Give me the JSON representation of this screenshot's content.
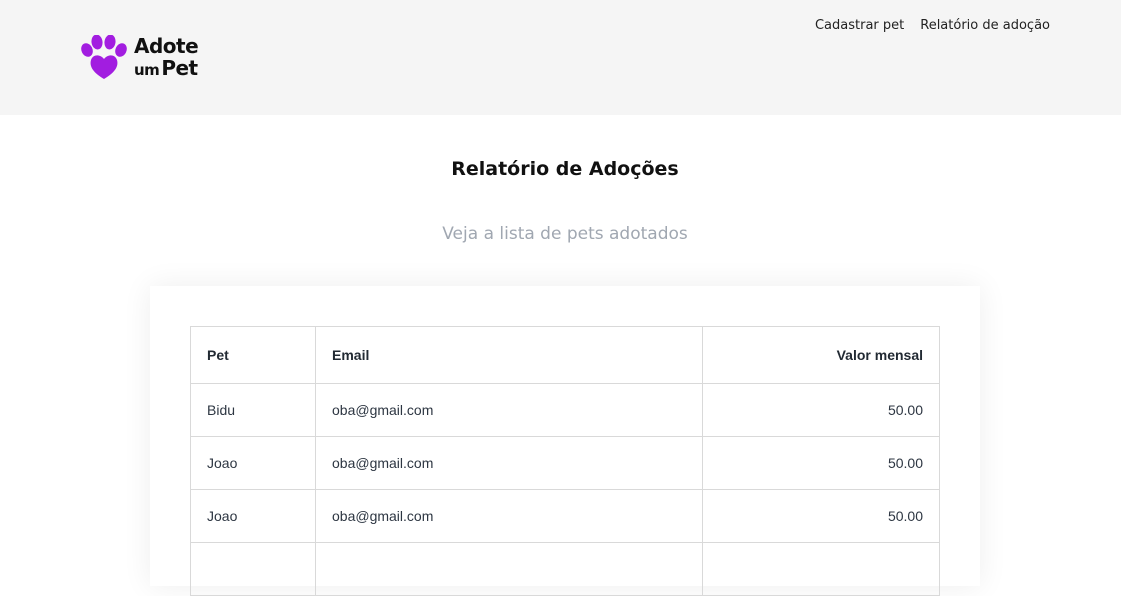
{
  "header": {
    "logo": {
      "line1": "Adote",
      "line2_small": "um",
      "line2_big": "Pet",
      "brand_color": "#a21de0"
    },
    "nav": [
      {
        "label": "Cadastrar pet"
      },
      {
        "label": "Relatório de adoção"
      }
    ]
  },
  "main": {
    "title": "Relatório de Adoções",
    "subtitle": "Veja a lista de pets adotados",
    "table": {
      "columns": [
        "Pet",
        "Email",
        "Valor mensal"
      ],
      "rows": [
        {
          "pet": "Bidu",
          "email": "oba@gmail.com",
          "valor": "50.00"
        },
        {
          "pet": "Joao",
          "email": "oba@gmail.com",
          "valor": "50.00"
        },
        {
          "pet": "Joao",
          "email": "oba@gmail.com",
          "valor": "50.00"
        },
        {
          "pet": "",
          "email": "",
          "valor": ""
        }
      ]
    }
  }
}
